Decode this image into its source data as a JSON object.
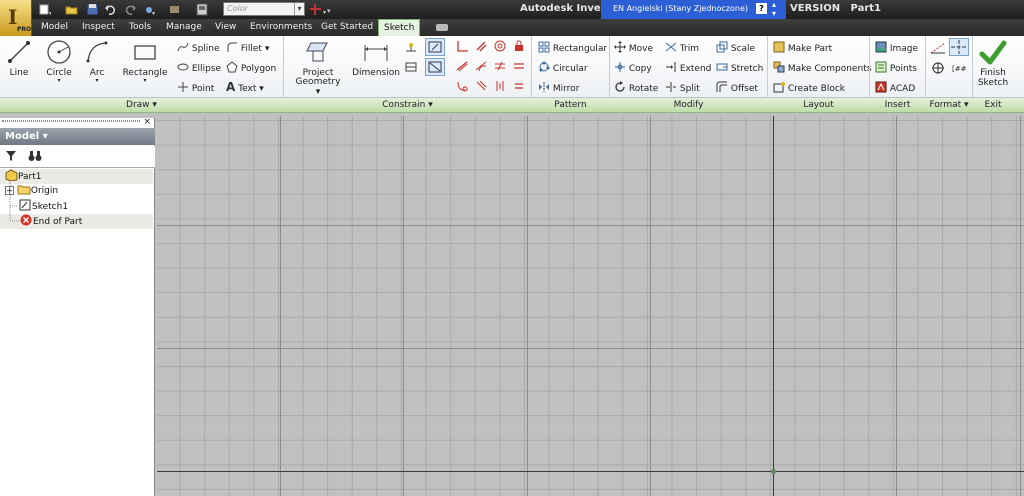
{
  "title_bar": {
    "app_title": "Autodesk Invent",
    "app_title_suffix": "VERSION",
    "document": "Part1",
    "color_combo_value": "Color",
    "language_indicator": "EN Angielski (Stany Zjednoczone)",
    "language_help": "?"
  },
  "app_button": {
    "logo": "I",
    "edition": "PRO"
  },
  "tabs": [
    {
      "label": "Model"
    },
    {
      "label": "Inspect"
    },
    {
      "label": "Tools"
    },
    {
      "label": "Manage"
    },
    {
      "label": "View"
    },
    {
      "label": "Environments"
    },
    {
      "label": "Get Started"
    },
    {
      "label": "Sketch"
    }
  ],
  "ribbon": {
    "draw": {
      "line": "Line",
      "circle": "Circle",
      "arc": "Arc",
      "rectangle": "Rectangle",
      "spline": "Spline",
      "ellipse": "Ellipse",
      "point": "Point",
      "fillet": "Fillet",
      "polygon": "Polygon",
      "text": "Text",
      "project_geometry_1": "Project",
      "project_geometry_2": "Geometry"
    },
    "constrain": {
      "dimension": "Dimension"
    },
    "pattern": {
      "rectangular": "Rectangular",
      "circular": "Circular",
      "mirror": "Mirror"
    },
    "modify": {
      "move": "Move",
      "copy": "Copy",
      "rotate": "Rotate",
      "trim": "Trim",
      "extend": "Extend",
      "split": "Split",
      "scale": "Scale",
      "stretch": "Stretch",
      "offset": "Offset"
    },
    "layout": {
      "make_part": "Make Part",
      "make_components": "Make Components",
      "create_block": "Create Block"
    },
    "insert": {
      "image": "Image",
      "points": "Points",
      "acad": "ACAD"
    },
    "exit": {
      "finish_1": "Finish",
      "finish_2": "Sketch"
    }
  },
  "panel_labels": {
    "draw": "Draw",
    "constrain": "Constrain",
    "pattern": "Pattern",
    "modify": "Modify",
    "layout": "Layout",
    "insert": "Insert",
    "format": "Format",
    "exit": "Exit"
  },
  "browser": {
    "title": "Model",
    "close": "×",
    "tree": [
      {
        "label": "Part1"
      },
      {
        "label": "Origin"
      },
      {
        "label": "Sketch1"
      },
      {
        "label": "End of Part"
      }
    ]
  },
  "colors": {
    "active_tab_bg": "#e6f2e0",
    "panel_bar": "#bfdca8",
    "canvas_bg": "#c0c0c0",
    "grid_line": "#a9a9a9",
    "axis_line": "#3a3a3a",
    "language_bar": "#2c5fd6",
    "finish_check": "#3b9e2e",
    "constraint_red": "#c8322a"
  },
  "icons": {
    "new": "new-icon",
    "open": "open-icon",
    "save": "save-icon",
    "undo": "undo-icon",
    "redo": "redo-icon",
    "filter": "filter-icon",
    "find": "binoculars-icon"
  }
}
